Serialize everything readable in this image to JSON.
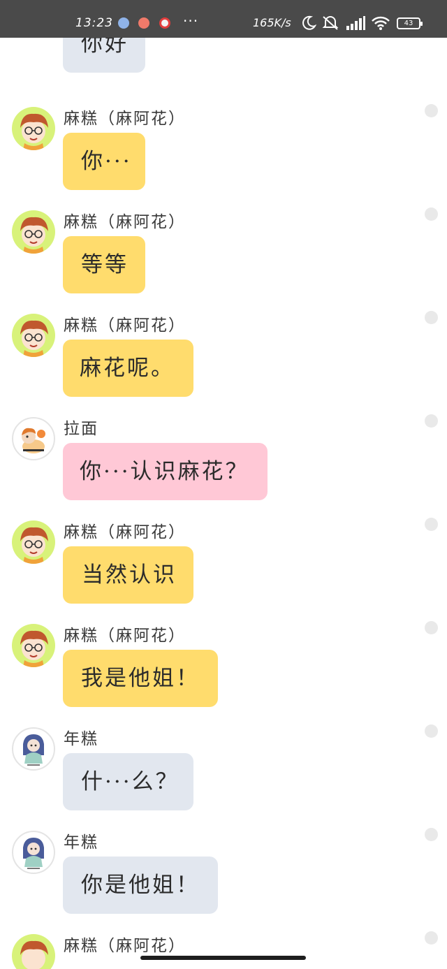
{
  "status_bar": {
    "time": "13:23",
    "dots": "···",
    "net_speed": "165K/s",
    "battery_level": "43",
    "icons": [
      "notification-app-icon",
      "notification-app-icon",
      "notification-app-icon",
      "moon-icon",
      "mute-icon",
      "signal-icon",
      "wifi-icon",
      "battery-icon"
    ]
  },
  "top_partial": {
    "text": "你好",
    "color": "#e2e7ef"
  },
  "messages": [
    {
      "sender": "麻糕（麻阿花）",
      "text": "你···",
      "bubble": "yellow",
      "avatar": "redhead-glasses"
    },
    {
      "sender": "麻糕（麻阿花）",
      "text": "等等",
      "bubble": "yellow",
      "avatar": "redhead-glasses"
    },
    {
      "sender": "麻糕（麻阿花）",
      "text": "麻花呢。",
      "bubble": "yellow",
      "avatar": "redhead-glasses"
    },
    {
      "sender": "拉面",
      "text": "你···认识麻花？",
      "bubble": "pink",
      "avatar": "orange-hair-character"
    },
    {
      "sender": "麻糕（麻阿花）",
      "text": "当然认识",
      "bubble": "yellow",
      "avatar": "redhead-glasses"
    },
    {
      "sender": "麻糕（麻阿花）",
      "text": "我是他姐！",
      "bubble": "yellow",
      "avatar": "redhead-glasses"
    },
    {
      "sender": "年糕",
      "text": "什···么？",
      "bubble": "grey",
      "avatar": "blue-hair-character"
    },
    {
      "sender": "年糕",
      "text": "你是他姐！",
      "bubble": "grey",
      "avatar": "blue-hair-character"
    },
    {
      "sender": "麻糕（麻阿花）",
      "text": "",
      "bubble": "yellow",
      "avatar": "redhead-glasses"
    }
  ],
  "colors": {
    "yellow_bubble": "#ffdc6d",
    "pink_bubble": "#ffc8d6",
    "grey_bubble": "#e2e7ef",
    "avatar_green": "#d8f27a",
    "status_bar": "#4a4a4a"
  }
}
